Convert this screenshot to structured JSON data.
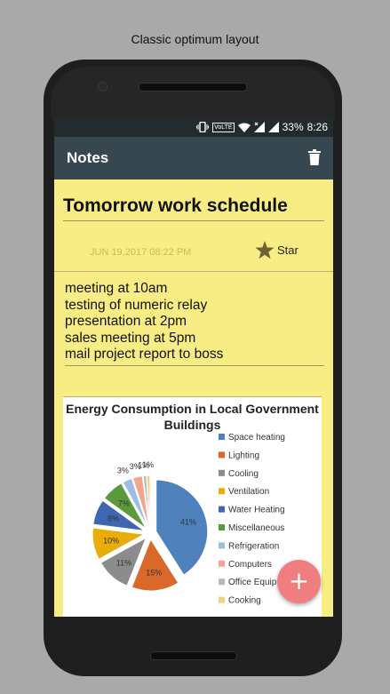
{
  "caption": "Classic optimum layout",
  "status_bar": {
    "volte": "VoLTE",
    "battery": "33%",
    "time": "8:26"
  },
  "app_bar": {
    "title": "Notes",
    "delete_icon": "trash-icon"
  },
  "note": {
    "title": "Tomorrow work schedule",
    "date": "JUN 19,2017  08:22 PM",
    "star_label": "Star",
    "body": "meeting at 10am\ntesting of numeric relay\npresentation at 2pm\nsales meeting at 5pm\nmail project report to boss"
  },
  "fab": {
    "label": "+"
  },
  "colors": {
    "app_bar": "#37474f",
    "status_bar": "#222b2e",
    "note_bg": "#f8ec84",
    "fab": "#f07e80"
  },
  "chart_data": {
    "type": "pie",
    "title": "Energy Consumption in Local Government Buildings",
    "legend_position": "right",
    "slices": [
      {
        "label": "Space heating",
        "value": 41,
        "color": "#4f81bd",
        "value_label": "41%"
      },
      {
        "label": "Lighting",
        "value": 15,
        "color": "#d9682a",
        "value_label": "15%"
      },
      {
        "label": "Cooling",
        "value": 11,
        "color": "#8c8c8c",
        "value_label": "11%"
      },
      {
        "label": "Ventilation",
        "value": 10,
        "color": "#e8ad06",
        "value_label": "10%"
      },
      {
        "label": "Water Heating",
        "value": 8,
        "color": "#3f67b1",
        "value_label": "8%"
      },
      {
        "label": "Miscellaneous",
        "value": 7,
        "color": "#5a9a3c",
        "value_label": "7%"
      },
      {
        "label": "Refrigeration",
        "value": 3,
        "color": "#9dbde2",
        "value_label": "3%"
      },
      {
        "label": "Computers",
        "value": 3,
        "color": "#f2a58b",
        "value_label": "3%"
      },
      {
        "label": "Office Equip",
        "value": 1,
        "color": "#b8b8b8",
        "value_label": "1%"
      },
      {
        "label": "Cooking",
        "value": 1,
        "color": "#f7cf80",
        "value_label": "1%"
      }
    ]
  }
}
